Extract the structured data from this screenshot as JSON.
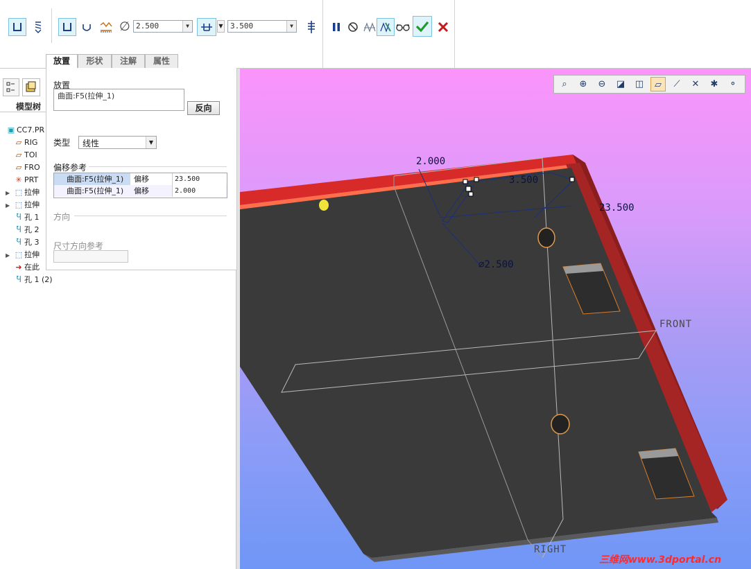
{
  "dashboard": {
    "diameter_value": "2.500",
    "depth_value": "3.500"
  },
  "tabs": [
    "放置",
    "形状",
    "注解",
    "属性"
  ],
  "tree": {
    "header": "模型树",
    "items": [
      {
        "label": "CC7.PR",
        "icon": "part-icon",
        "expandable": false
      },
      {
        "label": "RIG",
        "icon": "datum-plane-icon",
        "expandable": false
      },
      {
        "label": "TOI",
        "icon": "datum-plane-icon",
        "expandable": false
      },
      {
        "label": "FRO",
        "icon": "datum-plane-icon",
        "expandable": false
      },
      {
        "label": "PRT",
        "icon": "coordinate-system-icon",
        "expandable": false
      },
      {
        "label": "拉伸",
        "icon": "extrude-icon",
        "expandable": true
      },
      {
        "label": "拉伸",
        "icon": "extrude-icon",
        "expandable": true
      },
      {
        "label": "孔 1",
        "icon": "hole-icon",
        "expandable": false
      },
      {
        "label": "孔 2",
        "icon": "hole-icon",
        "expandable": false
      },
      {
        "label": "孔 3",
        "icon": "hole-icon",
        "expandable": false
      },
      {
        "label": "拉伸",
        "icon": "extrude-icon",
        "expandable": true
      },
      {
        "label": "在此",
        "icon": "insert-here-arrow-icon",
        "expandable": false
      },
      {
        "label": "孔 1 (2)",
        "icon": "hole-new-icon",
        "expandable": false
      }
    ]
  },
  "placement": {
    "section_label": "放置",
    "primary_ref": "曲面:F5(拉伸_1)",
    "flip_button": "反向",
    "type_label": "类型",
    "type_value": "线性",
    "offset_refs_label": "偏移参考",
    "offset_refs": [
      {
        "ref": "曲面:F5(拉伸_1)",
        "kind": "偏移",
        "value": "23.500"
      },
      {
        "ref": "曲面:F5(拉伸_1)",
        "kind": "偏移",
        "value": "2.000"
      }
    ],
    "direction_label": "方向",
    "dim_dir_ref_label": "尺寸方向参考"
  },
  "viewport": {
    "dims": {
      "d1": "2.000",
      "d2": "3.500",
      "d3": "23.500",
      "d4": "2.500"
    },
    "datum_labels": {
      "front": "FRONT",
      "right": "RIGHT"
    },
    "watermark": "三维网www.3dportal.cn"
  }
}
